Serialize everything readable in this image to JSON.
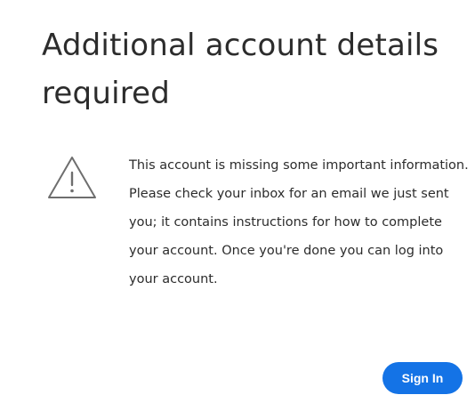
{
  "dialog": {
    "title": "Additional account details required",
    "warning_icon": "alert-triangle-icon",
    "message": "This account is missing some important information. Please check your inbox for an email we just sent you; it contains instructions for how to complete your account. Once you're done you can log into your account.",
    "sign_in_label": "Sign In"
  },
  "colors": {
    "accent": "#1473e6",
    "text": "#2c2c2c",
    "icon_stroke": "#6e6e6e"
  }
}
